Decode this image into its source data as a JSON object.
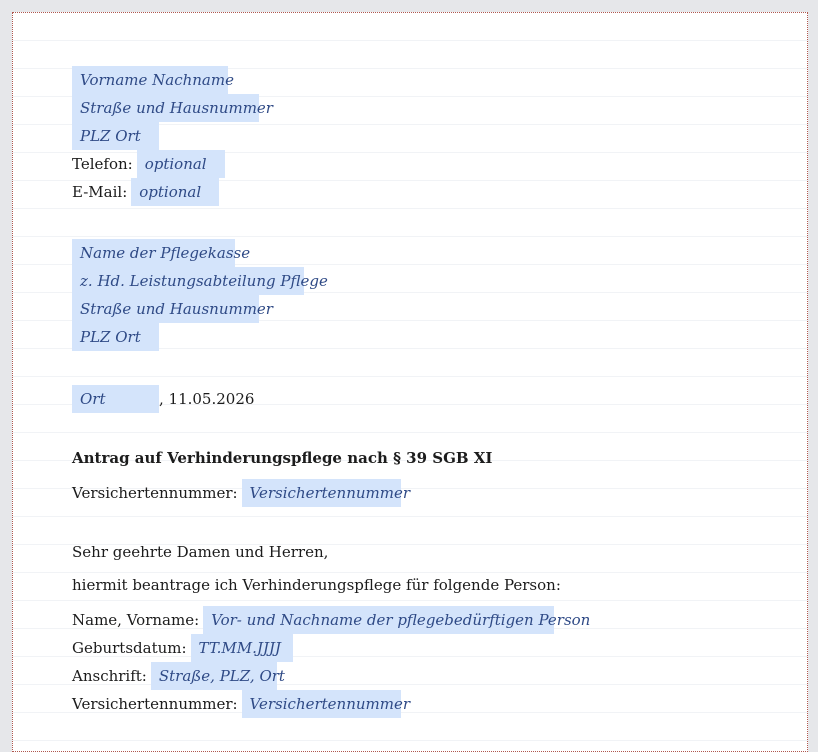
{
  "sender": {
    "name": "Vorname Nachname",
    "street": "Straße und Hausnummer",
    "city": "PLZ Ort",
    "phone_label": "Telefon:",
    "phone_value": "optional",
    "email_label": "E-Mail:",
    "email_value": "optional"
  },
  "recipient": {
    "name": "Name der Pflegekasse",
    "attn": "z. Hd. Leistungsabteilung Pflege",
    "street": "Straße und Hausnummer",
    "city": "PLZ Ort"
  },
  "date_line": {
    "place": "Ort",
    "date": ", 11.05.2026"
  },
  "subject": "Antrag auf Verhinderungspflege nach § 39 SGB XI",
  "insurance": {
    "label": "Versichertennummer:",
    "value": "Versichertennummer"
  },
  "body": {
    "greeting": "Sehr geehrte Damen und Herren,",
    "intro": "hiermit beantrage ich Verhinderungspflege für folgende Person:"
  },
  "person": {
    "name_label": "Name, Vorname:",
    "name_value": "Vor- und Nachname der pflegebedürftigen Person",
    "birth_label": "Geburtsdatum:",
    "birth_value": "TT.MM.JJJJ",
    "address_label": "Anschrift:",
    "address_value": "Straße, PLZ, Ort",
    "insurance_label": "Versichertennummer:",
    "insurance_value": "Versichertennummer"
  }
}
